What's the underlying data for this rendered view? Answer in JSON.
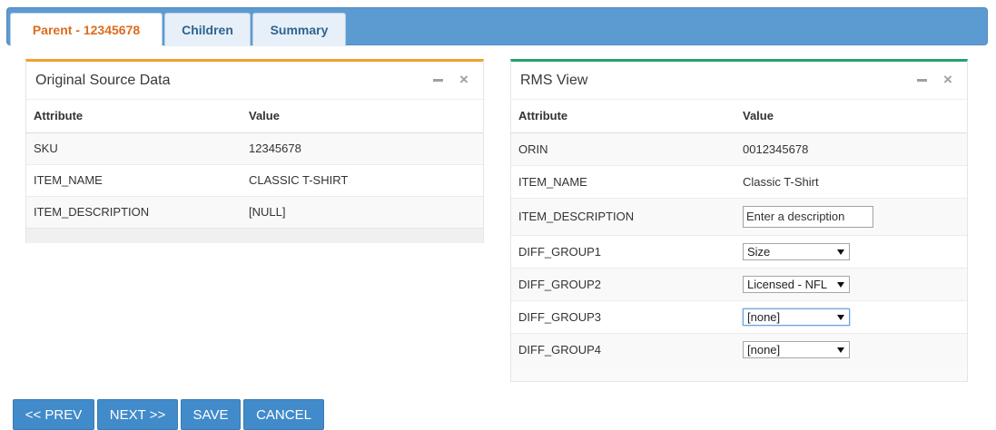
{
  "tabs": [
    {
      "label": "Parent - 12345678",
      "active": true
    },
    {
      "label": "Children",
      "active": false
    },
    {
      "label": "Summary",
      "active": false
    }
  ],
  "source_panel": {
    "title": "Original Source Data",
    "headers": {
      "attribute": "Attribute",
      "value": "Value"
    },
    "rows": [
      {
        "attribute": "SKU",
        "value": "12345678"
      },
      {
        "attribute": "ITEM_NAME",
        "value": "CLASSIC T-SHIRT"
      },
      {
        "attribute": "ITEM_DESCRIPTION",
        "value": "[NULL]"
      }
    ]
  },
  "rms_panel": {
    "title": "RMS View",
    "headers": {
      "attribute": "Attribute",
      "value": "Value"
    },
    "rows": [
      {
        "attribute": "ORIN",
        "value": "0012345678"
      },
      {
        "attribute": "ITEM_NAME",
        "value": "Classic T-Shirt"
      },
      {
        "attribute": "ITEM_DESCRIPTION",
        "placeholder": "Enter a description"
      },
      {
        "attribute": "DIFF_GROUP1",
        "selected": "Size"
      },
      {
        "attribute": "DIFF_GROUP2",
        "selected": "Licensed - NFL"
      },
      {
        "attribute": "DIFF_GROUP3",
        "selected": "[none]"
      },
      {
        "attribute": "DIFF_GROUP4",
        "selected": "[none]"
      }
    ]
  },
  "buttons": {
    "prev": "<< PREV",
    "next": "NEXT >>",
    "save": "SAVE",
    "cancel": "CANCEL"
  },
  "icons": {
    "minimize": "minimize-icon",
    "close": "close-icon"
  },
  "colors": {
    "tabbar": "#5b9bd1",
    "active_tab_text": "#dd6c1c",
    "source_accent": "#f0a12c",
    "rms_accent": "#26a26c",
    "button": "#428bca"
  }
}
